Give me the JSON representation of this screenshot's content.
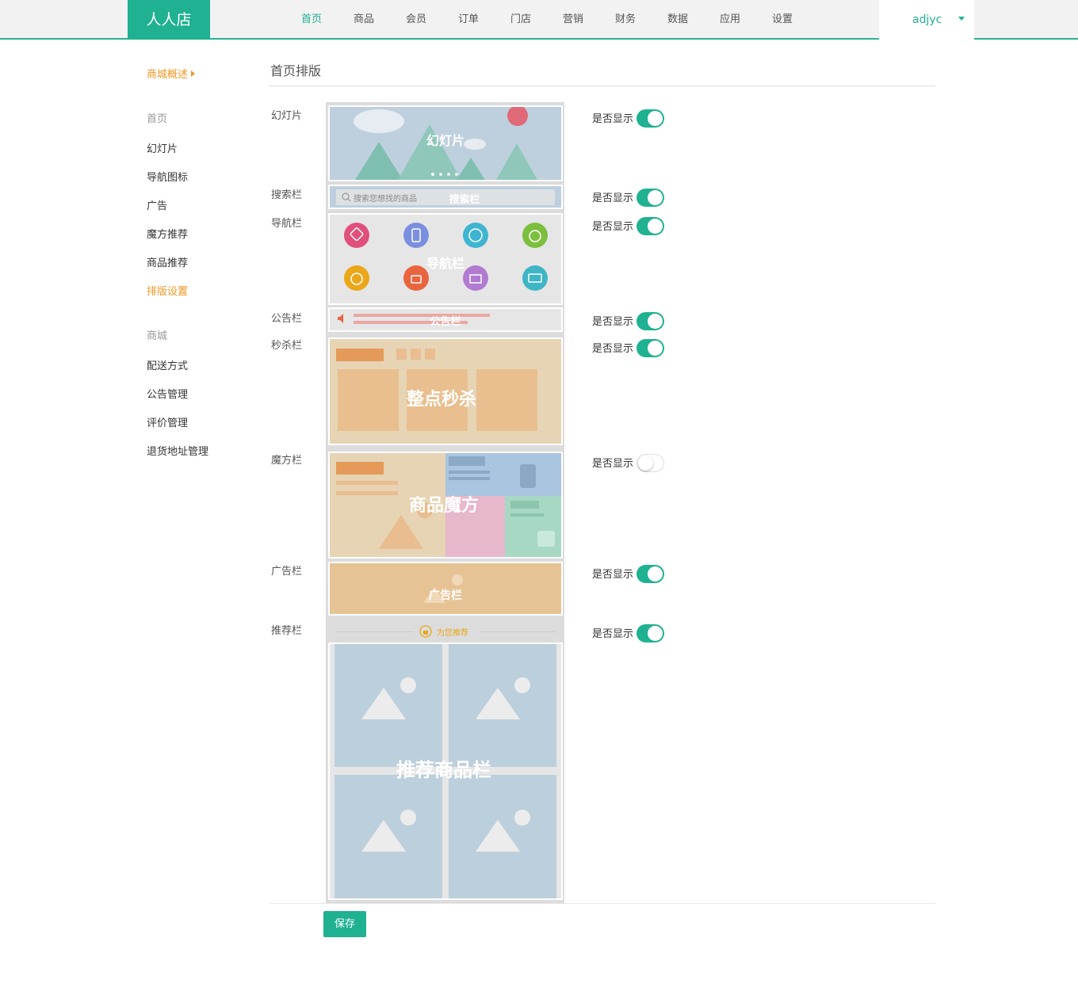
{
  "header": {
    "logo": "人人店",
    "nav": [
      "首页",
      "商品",
      "会员",
      "订单",
      "门店",
      "营销",
      "财务",
      "数据",
      "应用",
      "设置"
    ],
    "active_nav": "首页",
    "username": "adjyc"
  },
  "sidebar": {
    "overview": "商城概述",
    "group_home": "首页",
    "home_items": [
      "幻灯片",
      "导航图标",
      "广告",
      "魔方推荐",
      "商品推荐",
      "排版设置"
    ],
    "active_item": "排版设置",
    "group_shop": "商城",
    "shop_items": [
      "配送方式",
      "公告管理",
      "评价管理",
      "退货地址管理"
    ]
  },
  "page": {
    "title": "首页排版",
    "show_label": "是否显示",
    "save_label": "保存"
  },
  "sections": [
    {
      "label": "幻灯片",
      "preview_text": "幻灯片",
      "show": true
    },
    {
      "label": "搜索栏",
      "preview_text": "搜索栏",
      "placeholder": "搜索您想找的商品",
      "show": true
    },
    {
      "label": "导航栏",
      "preview_text": "导航栏",
      "show": true
    },
    {
      "label": "公告栏",
      "preview_text": "公告栏",
      "show": true
    },
    {
      "label": "秒杀栏",
      "preview_text": "整点秒杀",
      "show": true
    },
    {
      "label": "魔方栏",
      "preview_text": "商品魔方",
      "show": false
    },
    {
      "label": "广告栏",
      "preview_text": "广告栏",
      "show": true
    },
    {
      "label": "推荐栏",
      "preview_text": "推荐商品栏",
      "header_text": "为您推荐",
      "show": true
    }
  ],
  "colors": {
    "brand": "#1fb192",
    "accent_orange": "#f19722",
    "nav_icon_colors": [
      "#e0507a",
      "#7b8fe0",
      "#3fb5d1",
      "#7cbf3f",
      "#eba71a",
      "#e9653f",
      "#b07bd0",
      "#3fb5c6"
    ]
  }
}
